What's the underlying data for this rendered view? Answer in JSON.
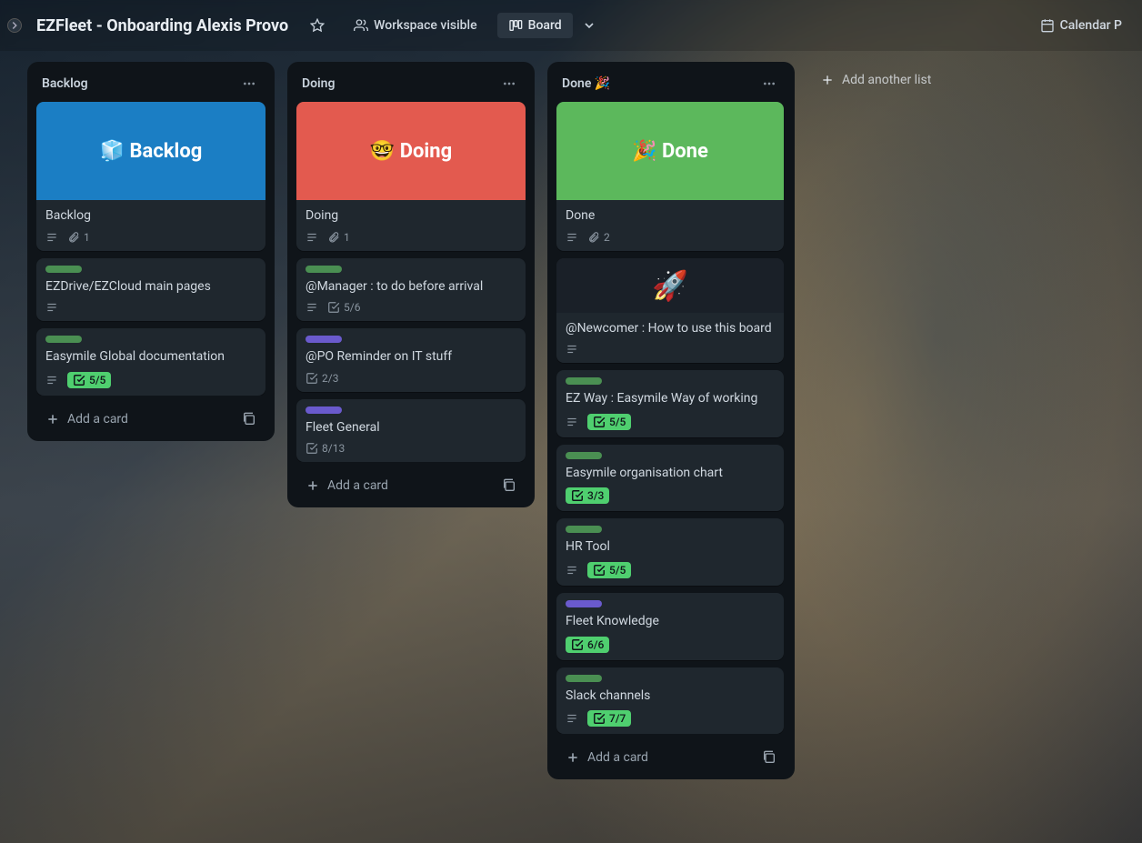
{
  "header": {
    "title": "EZFleet - Onboarding Alexis Provo",
    "workspace_visible": "Workspace visible",
    "board_btn": "Board",
    "calendar": "Calendar P"
  },
  "lists": {
    "backlog": {
      "title": "Backlog",
      "cover_text": "🧊 Backlog",
      "cards": [
        {
          "title": "Backlog",
          "attachments": "1"
        },
        {
          "title": "EZDrive/EZCloud main pages"
        },
        {
          "title": "Easymile Global documentation",
          "checklist": "5/5"
        }
      ]
    },
    "doing": {
      "title": "Doing",
      "cover_text": "🤓 Doing",
      "cards": [
        {
          "title": "Doing",
          "attachments": "1"
        },
        {
          "title": "@Manager : to do before arrival",
          "checklist": "5/6"
        },
        {
          "title": "@PO Reminder on IT stuff",
          "checklist": "2/3"
        },
        {
          "title": "Fleet General",
          "checklist": "8/13"
        }
      ]
    },
    "done": {
      "title": "Done 🎉",
      "cover_text": "🎉 Done",
      "cards": [
        {
          "title": "Done",
          "attachments": "2"
        },
        {
          "title": "@Newcomer : How to use this board"
        },
        {
          "title": "EZ Way : Easymile Way of working",
          "checklist": "5/5"
        },
        {
          "title": "Easymile organisation chart",
          "checklist": "3/3"
        },
        {
          "title": "HR Tool",
          "checklist": "5/5"
        },
        {
          "title": "Fleet Knowledge",
          "checklist": "6/6"
        },
        {
          "title": "Slack channels",
          "checklist": "7/7"
        }
      ]
    }
  },
  "add_card": "Add a card",
  "add_list": "Add another list"
}
